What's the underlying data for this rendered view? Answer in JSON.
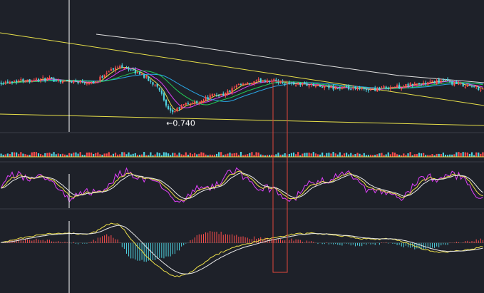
{
  "chart_data": [
    {
      "type": "candlestick",
      "panel": "price",
      "annotation": {
        "text": "←0.740",
        "value": 0.74,
        "index": 77
      },
      "close_start": 0.8,
      "close_end": 0.79,
      "ylim": [
        0.7,
        0.92
      ],
      "n": 220,
      "series": [
        {
          "color": "#e0e0e0"
        },
        {
          "color": "#f0e24a"
        },
        {
          "color": "#e040fb"
        },
        {
          "color": "#29a8e8"
        },
        {
          "color": "#22cc55"
        }
      ],
      "trendlines_color": "#e8e04a",
      "up_color": "#ff4d4d",
      "down_color": "#4fd3e0",
      "grid": false
    },
    {
      "type": "bar",
      "panel": "volume",
      "values_range": [
        2,
        7
      ]
    },
    {
      "type": "line",
      "panel": "oscillator",
      "series": [
        {
          "color": "#e040fb"
        },
        {
          "color": "#f0e24a"
        },
        {
          "color": "#e8e8e8"
        }
      ],
      "ylim": [
        0,
        100
      ]
    },
    {
      "type": "bar",
      "panel": "macd",
      "series": [
        {
          "color": "#f0e24a"
        },
        {
          "color": "#e8e8e8"
        }
      ],
      "up_color": "#ff4d4d",
      "down_color": "#4fd3e0",
      "ylim": [
        -0.06,
        0.04
      ]
    }
  ],
  "colors": {
    "background": "#1e2129",
    "separator": "#3a3d46",
    "crosshair": "#ffffff",
    "highlight": "#e0463a"
  }
}
